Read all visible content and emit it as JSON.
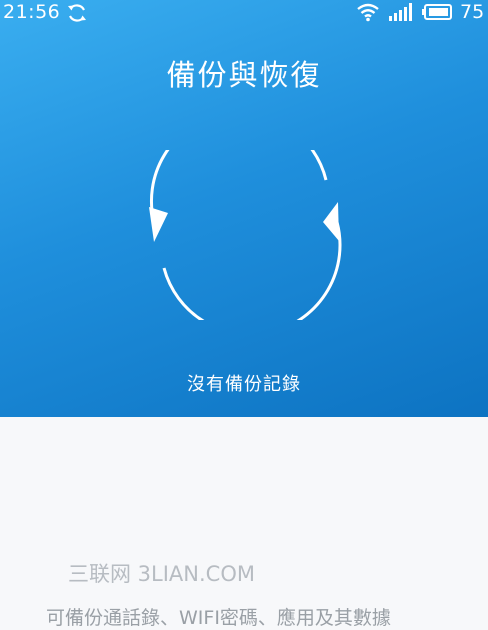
{
  "status_bar": {
    "time": "21:56",
    "battery_level": "75",
    "icons": [
      "sync-icon",
      "wifi-icon",
      "signal-icon",
      "battery-icon"
    ]
  },
  "header": {
    "title": "備份與恢復"
  },
  "main": {
    "status_text": "沒有備份記錄",
    "info_text": "可備份通話錄、WIFI密碼、應用及其數據"
  },
  "watermark": {
    "text": "三联网 3LIAN.COM"
  },
  "colors": {
    "hero_gradient_start": "#3aaef0",
    "hero_gradient_end": "#0d73c2",
    "lower_background": "#f7f8fa",
    "foreground": "#ffffff"
  }
}
